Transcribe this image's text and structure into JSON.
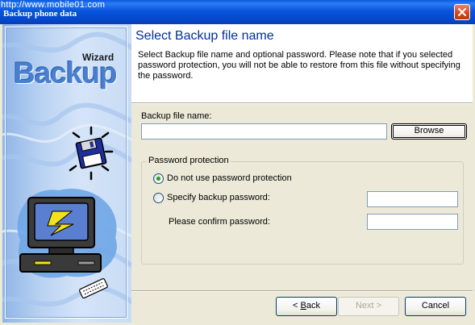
{
  "window": {
    "title": "Backup phone data",
    "watermark": "http://www.mobile01.com"
  },
  "sidebar": {
    "wizard_label": "Wizard",
    "logo_text": "Backup"
  },
  "header": {
    "title": "Select Backup file name",
    "description": "Select Backup file name and optional password. Please note that if you selected password protection, you will not be able to restore from this file without specifying the password."
  },
  "file": {
    "label": "Backup file name:",
    "value": "",
    "browse_label": "Browse"
  },
  "password_group": {
    "legend": "Password protection",
    "option_none": "Do not use password protection",
    "option_specify": "Specify backup password:",
    "confirm_label": "Please confirm password:",
    "selected": "none",
    "password_value": "",
    "confirm_value": ""
  },
  "footer": {
    "back_prefix": "< ",
    "back_key": "B",
    "back_rest": "ack",
    "next_label": "Next >",
    "cancel_label": "Cancel"
  },
  "colors": {
    "title_bar": "#0854dc",
    "header_title": "#00309c",
    "sidebar_logo": "#4a7fd0",
    "close_button": "#d4481f",
    "radio_dot": "#21a121"
  },
  "icons": [
    "close-icon",
    "floppy-disk-icon",
    "computer-icon",
    "keyboard-icon"
  ]
}
